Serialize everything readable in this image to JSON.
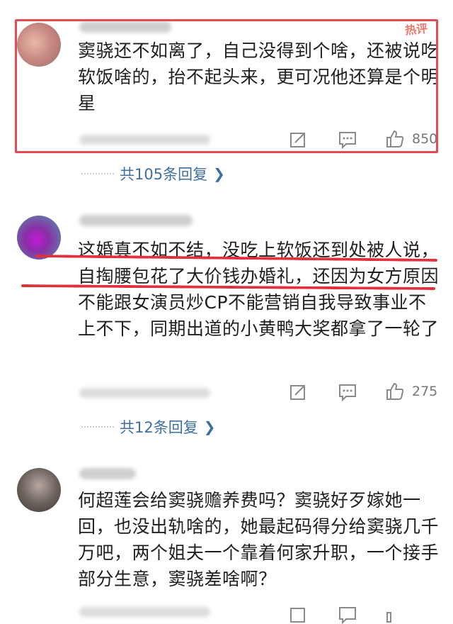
{
  "comments": [
    {
      "text": "窦骁还不如离了，自己没得到个啥，还被说吃软饭啥的，抬不起头来，更可况他还算是个明星",
      "hot_label": "热评",
      "like_count": "850",
      "replies_label": "共105条回复"
    },
    {
      "text": "这婚真不如不结，没吃上软饭还到处被人说，自掏腰包花了大价钱办婚礼，还因为女方原因不能跟女演员炒CP不能营销自我导致事业不上不下，同期出道的小黄鸭大奖都拿了一轮了",
      "like_count": "275",
      "replies_label": "共12条回复"
    },
    {
      "text": "何超莲会给窦骁赡养费吗？窦骁好歹嫁她一回，也没出轨啥的，她最起码得分给窦骁几千万吧，两个姐夫一个靠着何家升职，一个接手部分生意，窦骁差啥啊？"
    }
  ],
  "colors": {
    "highlight_red": "#e2303c",
    "link_blue": "#3d6fa3",
    "icon_gray": "#8a8a8a"
  },
  "icons": [
    "share-icon",
    "comment-icon",
    "thumb-up-icon",
    "chevron-right-icon"
  ]
}
